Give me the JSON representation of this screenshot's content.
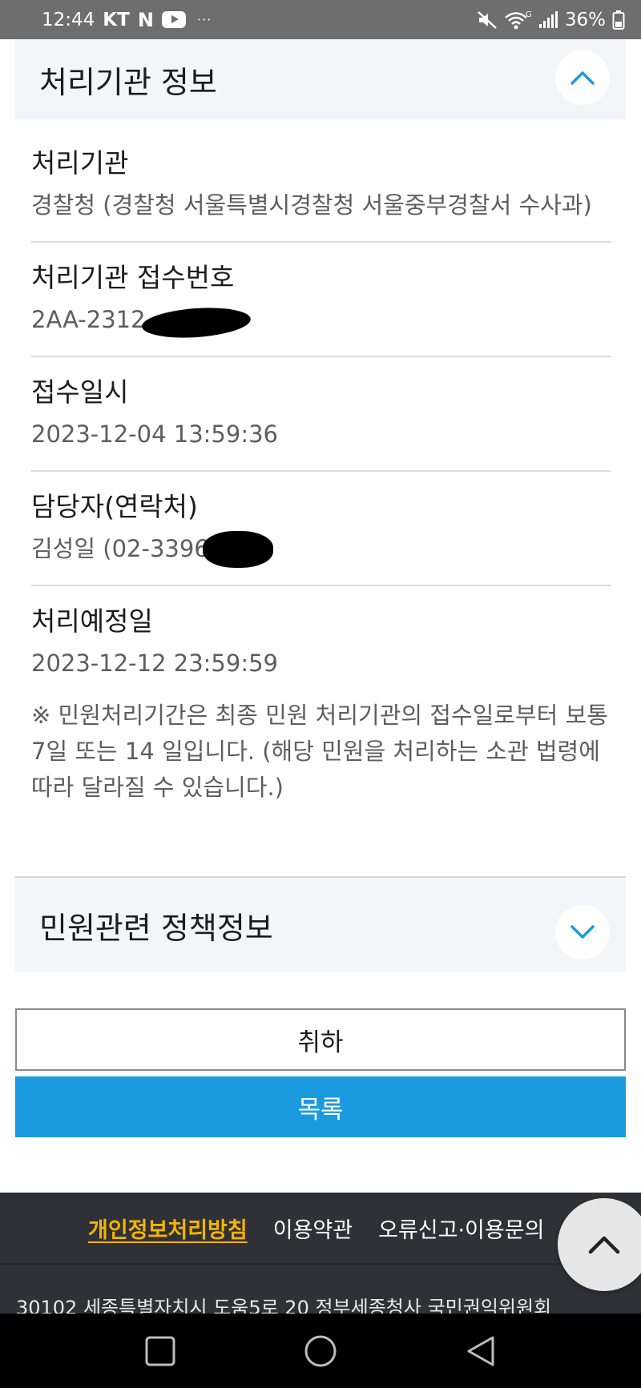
{
  "status_bar": {
    "time": "12:44",
    "carrier": "KT",
    "battery": "36%"
  },
  "section_processing": {
    "title": "처리기관 정보",
    "toggle_icon": "chevron-up-icon",
    "items": [
      {
        "label": "처리기관",
        "value": "경찰청 (경찰청 서울특별시경찰청 서울중부경찰서 수사과)"
      },
      {
        "label": "처리기관 접수번호",
        "value": "2AA-2312-"
      },
      {
        "label": "접수일시",
        "value": "2023-12-04 13:59:36"
      },
      {
        "label": "담당자(연락처)",
        "value": "김성일 (02-3396-"
      },
      {
        "label": "처리예정일",
        "value": "2023-12-12 23:59:59"
      }
    ],
    "notice": "※ 민원처리기간은 최종 민원 처리기관의 접수일로부터 보통 7일 또는 14 일입니다. (해당 민원을 처리하는 소관 법령에 따라 달라질 수 있습니다.)"
  },
  "section_policy": {
    "title": "민원관련 정책정보",
    "toggle_icon": "chevron-down-icon"
  },
  "buttons": {
    "cancel": "취하",
    "list": "목록"
  },
  "footer": {
    "links": [
      "개인정보처리방침",
      "이용약관",
      "오류신고·이용문의"
    ],
    "address": "30102 세종특별자치시 도움5로 20 정부세종청사 국민권익위원회"
  },
  "colors": {
    "accent": "#1a9be0",
    "footer_bg": "#2f3136",
    "footer_highlight": "#f5b400",
    "section_bg": "#f4f5f9"
  }
}
